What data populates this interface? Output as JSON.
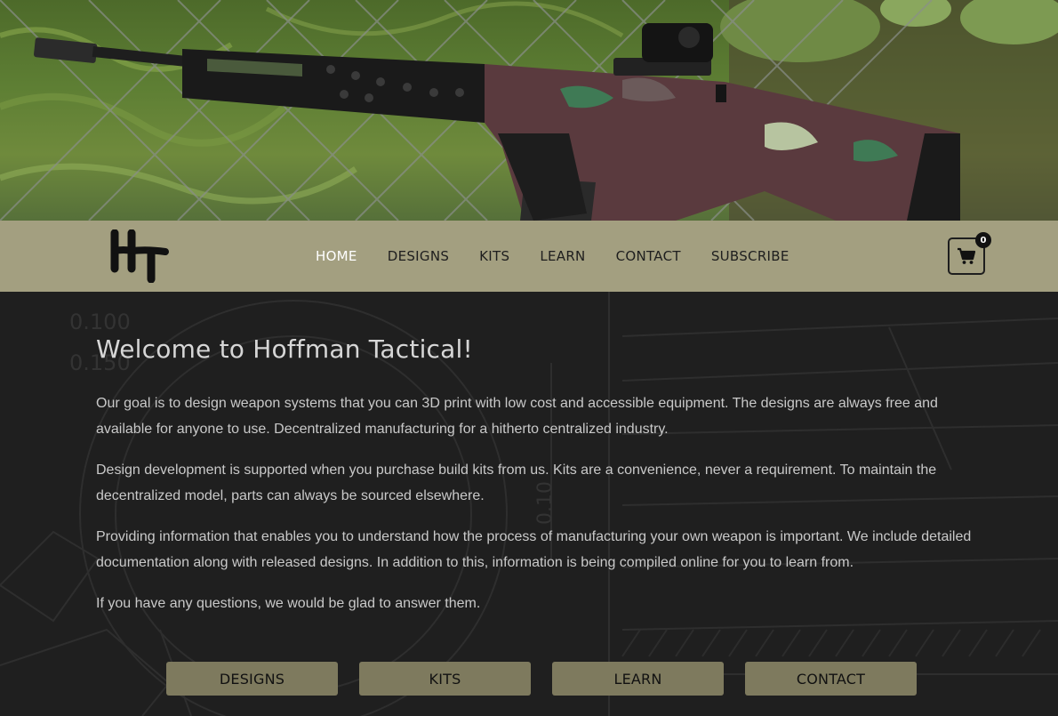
{
  "nav": {
    "links": [
      {
        "label": "HOME",
        "active": true
      },
      {
        "label": "DESIGNS",
        "active": false
      },
      {
        "label": "KITS",
        "active": false
      },
      {
        "label": "LEARN",
        "active": false
      },
      {
        "label": "CONTACT",
        "active": false
      },
      {
        "label": "SUBSCRIBE",
        "active": false
      }
    ],
    "cart_count": "0",
    "cart_icon": "shopping-cart-icon"
  },
  "logo": {
    "text": "HT",
    "icon": "hoffman-tactical-logo"
  },
  "main": {
    "title": "Welcome to Hoffman Tactical!",
    "paragraphs": [
      "Our goal is to design weapon systems that you can 3D print with low cost and accessible equipment. The designs are always free and available for anyone to use. Decentralized manufacturing for a hitherto centralized industry.",
      "Design development is supported when you purchase build kits from us. Kits are a convenience, never a requirement. To maintain the decentralized model, parts can always be sourced elsewhere.",
      "Providing information that enables you to understand how the process of manufacturing your own weapon is important. We include detailed documentation along with released designs. In addition to this, information is being compiled online for you to learn from.",
      "If you have any questions, we would be glad to answer them."
    ],
    "buttons": [
      "DESIGNS",
      "KITS",
      "LEARN",
      "CONTACT"
    ]
  },
  "background": {
    "blueprint_labels": [
      "0.100",
      "0.150",
      "0.10"
    ]
  },
  "colors": {
    "navbar": "#a39f80",
    "button": "#7e7a5e",
    "main_bg": "#1f1f1f",
    "active_link": "#ffffff"
  }
}
